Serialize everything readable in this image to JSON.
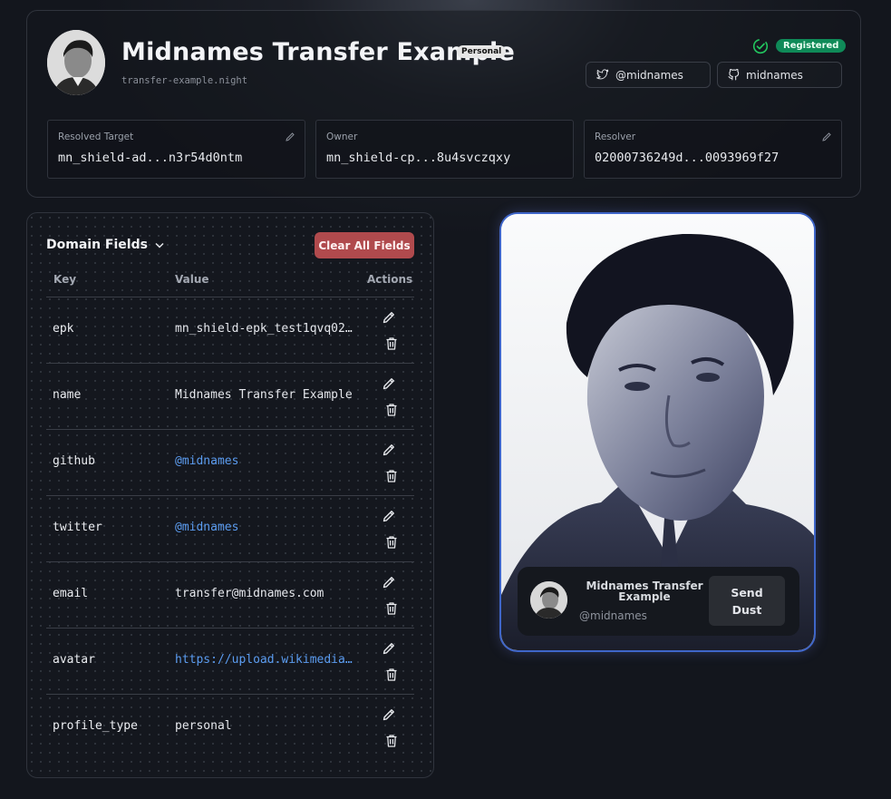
{
  "header": {
    "title": "Midnames Transfer Example",
    "profile_badge": "Personal",
    "domain": "transfer-example.night",
    "status": "Registered",
    "twitter_label": "@midnames",
    "github_label": "midnames"
  },
  "info": [
    {
      "label": "Resolved Target",
      "value": "mn_shield-ad...n3r54d0ntm",
      "editable": true
    },
    {
      "label": "Owner",
      "value": "mn_shield-cp...8u4svczqxy",
      "editable": false
    },
    {
      "label": "Resolver",
      "value": "02000736249d...0093969f27",
      "editable": true
    }
  ],
  "fields": {
    "title": "Domain Fields",
    "clear_label": "Clear All Fields",
    "col_key": "Key",
    "col_value": "Value",
    "col_actions": "Actions",
    "rows": [
      {
        "key": "epk",
        "value": "mn_shield-epk_test1qvq022…",
        "link": false
      },
      {
        "key": "name",
        "value": "Midnames Transfer Example",
        "link": false
      },
      {
        "key": "github",
        "value": "@midnames",
        "link": true
      },
      {
        "key": "twitter",
        "value": "@midnames",
        "link": true
      },
      {
        "key": "email",
        "value": "transfer@midnames.com",
        "link": false
      },
      {
        "key": "avatar",
        "value": "https://upload.wikimedia.…",
        "link": true
      },
      {
        "key": "profile_type",
        "value": "personal",
        "link": false
      }
    ]
  },
  "card": {
    "name": "Midnames Transfer Example",
    "handle": "@midnames",
    "send_label_1": "Send",
    "send_label_2": "Dust"
  },
  "colors": {
    "registered": "#0f8a58",
    "clear_button": "#b04a4d",
    "link": "#5b9cf0",
    "card_border": "#3f66c9"
  }
}
